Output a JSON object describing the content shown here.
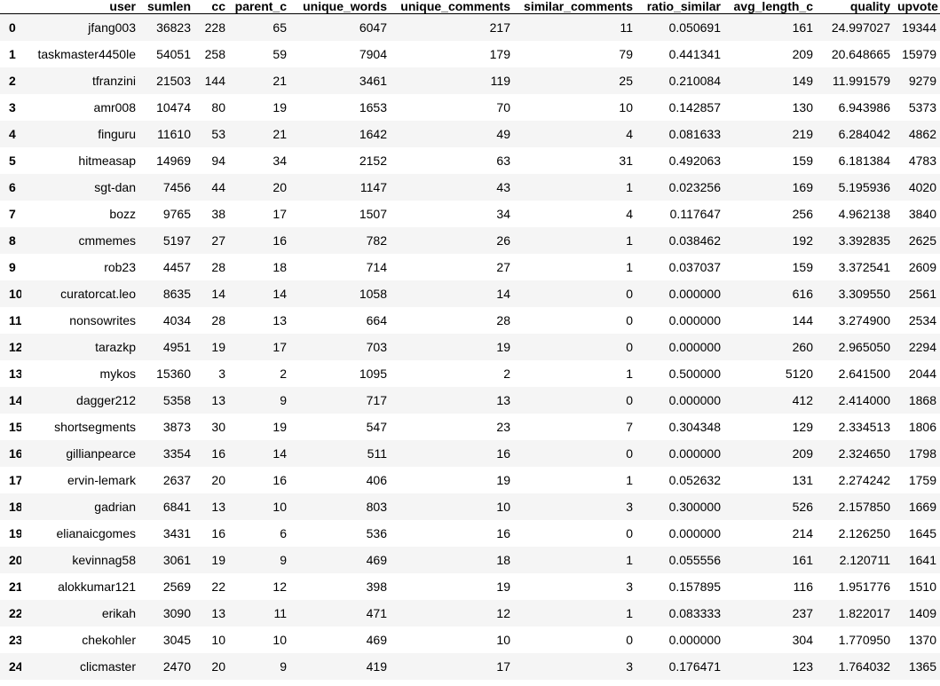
{
  "columns": [
    "",
    "user",
    "sumlen",
    "cc",
    "parent_c",
    "unique_words",
    "unique_comments",
    "similar_comments",
    "ratio_similar",
    "avg_length_c",
    "quality",
    "upvote"
  ],
  "rows": [
    [
      "0",
      "jfang003",
      "36823",
      "228",
      "65",
      "6047",
      "217",
      "11",
      "0.050691",
      "161",
      "24.997027",
      "19344"
    ],
    [
      "1",
      "taskmaster4450le",
      "54051",
      "258",
      "59",
      "7904",
      "179",
      "79",
      "0.441341",
      "209",
      "20.648665",
      "15979"
    ],
    [
      "2",
      "tfranzini",
      "21503",
      "144",
      "21",
      "3461",
      "119",
      "25",
      "0.210084",
      "149",
      "11.991579",
      "9279"
    ],
    [
      "3",
      "amr008",
      "10474",
      "80",
      "19",
      "1653",
      "70",
      "10",
      "0.142857",
      "130",
      "6.943986",
      "5373"
    ],
    [
      "4",
      "finguru",
      "11610",
      "53",
      "21",
      "1642",
      "49",
      "4",
      "0.081633",
      "219",
      "6.284042",
      "4862"
    ],
    [
      "5",
      "hitmeasap",
      "14969",
      "94",
      "34",
      "2152",
      "63",
      "31",
      "0.492063",
      "159",
      "6.181384",
      "4783"
    ],
    [
      "6",
      "sgt-dan",
      "7456",
      "44",
      "20",
      "1147",
      "43",
      "1",
      "0.023256",
      "169",
      "5.195936",
      "4020"
    ],
    [
      "7",
      "bozz",
      "9765",
      "38",
      "17",
      "1507",
      "34",
      "4",
      "0.117647",
      "256",
      "4.962138",
      "3840"
    ],
    [
      "8",
      "cmmemes",
      "5197",
      "27",
      "16",
      "782",
      "26",
      "1",
      "0.038462",
      "192",
      "3.392835",
      "2625"
    ],
    [
      "9",
      "rob23",
      "4457",
      "28",
      "18",
      "714",
      "27",
      "1",
      "0.037037",
      "159",
      "3.372541",
      "2609"
    ],
    [
      "10",
      "curatorcat.leo",
      "8635",
      "14",
      "14",
      "1058",
      "14",
      "0",
      "0.000000",
      "616",
      "3.309550",
      "2561"
    ],
    [
      "11",
      "nonsowrites",
      "4034",
      "28",
      "13",
      "664",
      "28",
      "0",
      "0.000000",
      "144",
      "3.274900",
      "2534"
    ],
    [
      "12",
      "tarazkp",
      "4951",
      "19",
      "17",
      "703",
      "19",
      "0",
      "0.000000",
      "260",
      "2.965050",
      "2294"
    ],
    [
      "13",
      "mykos",
      "15360",
      "3",
      "2",
      "1095",
      "2",
      "1",
      "0.500000",
      "5120",
      "2.641500",
      "2044"
    ],
    [
      "14",
      "dagger212",
      "5358",
      "13",
      "9",
      "717",
      "13",
      "0",
      "0.000000",
      "412",
      "2.414000",
      "1868"
    ],
    [
      "15",
      "shortsegments",
      "3873",
      "30",
      "19",
      "547",
      "23",
      "7",
      "0.304348",
      "129",
      "2.334513",
      "1806"
    ],
    [
      "16",
      "gillianpearce",
      "3354",
      "16",
      "14",
      "511",
      "16",
      "0",
      "0.000000",
      "209",
      "2.324650",
      "1798"
    ],
    [
      "17",
      "ervin-lemark",
      "2637",
      "20",
      "16",
      "406",
      "19",
      "1",
      "0.052632",
      "131",
      "2.274242",
      "1759"
    ],
    [
      "18",
      "gadrian",
      "6841",
      "13",
      "10",
      "803",
      "10",
      "3",
      "0.300000",
      "526",
      "2.157850",
      "1669"
    ],
    [
      "19",
      "elianaicgomes",
      "3431",
      "16",
      "6",
      "536",
      "16",
      "0",
      "0.000000",
      "214",
      "2.126250",
      "1645"
    ],
    [
      "20",
      "kevinnag58",
      "3061",
      "19",
      "9",
      "469",
      "18",
      "1",
      "0.055556",
      "161",
      "2.120711",
      "1641"
    ],
    [
      "21",
      "alokkumar121",
      "2569",
      "22",
      "12",
      "398",
      "19",
      "3",
      "0.157895",
      "116",
      "1.951776",
      "1510"
    ],
    [
      "22",
      "erikah",
      "3090",
      "13",
      "11",
      "471",
      "12",
      "1",
      "0.083333",
      "237",
      "1.822017",
      "1409"
    ],
    [
      "23",
      "chekohler",
      "3045",
      "10",
      "10",
      "469",
      "10",
      "0",
      "0.000000",
      "304",
      "1.770950",
      "1370"
    ],
    [
      "24",
      "clicmaster",
      "2470",
      "20",
      "9",
      "419",
      "17",
      "3",
      "0.176471",
      "123",
      "1.764032",
      "1365"
    ]
  ]
}
